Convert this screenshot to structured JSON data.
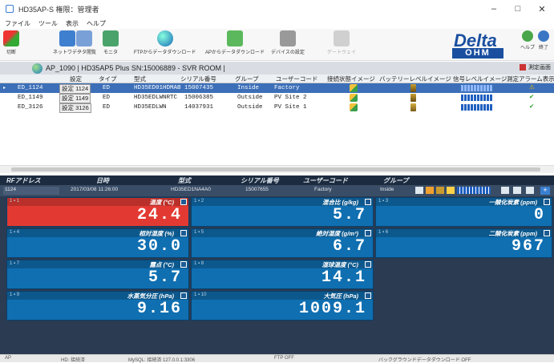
{
  "window": {
    "title": "HD35AP-S 権限：管理者"
  },
  "menu": [
    "ファイル",
    "ツール",
    "表示",
    "ヘルプ"
  ],
  "toolbar": {
    "items": [
      "切断",
      "ネットワーク",
      "データ閲覧",
      "モニタ",
      "FTPからデータダウンロード",
      "APからデータダウンロード",
      "デバイスの設定",
      "ゲートウェイ"
    ],
    "help": "ヘルプ",
    "exit": "終了"
  },
  "logo": {
    "top": "Delta",
    "bottom": "OHM",
    "color": "#1a4fa0"
  },
  "infobar": {
    "text": "AP_1090 | HD35AP5 Plus SN:15006889 - SVR ROOM |",
    "channel_label": "測定画面"
  },
  "table": {
    "headers": [
      "設定",
      "タイプ",
      "型式",
      "シリアル番号",
      "グループ",
      "ユーザーコード",
      "接続状態イメージ",
      "バッテリーレベルイメージ",
      "信号レベルイメージ",
      "測定アラーム表示"
    ],
    "rows": [
      {
        "id": "ED_1124",
        "setting": "設定",
        "code": "1124",
        "type": "ED",
        "model": "HD35ED01HDMAB",
        "serial": "15007435",
        "group": "Inside",
        "user": "Factory",
        "alarm": "⚠"
      },
      {
        "id": "ED_1149",
        "setting": "設定",
        "code": "1149",
        "type": "ED",
        "model": "HD35EDLWNRTC",
        "serial": "15006385",
        "group": "Outside",
        "user": "PV Site 2",
        "alarm": "✔"
      },
      {
        "id": "ED_3126",
        "setting": "設定",
        "code": "3126",
        "type": "ED",
        "model": "HD35EDLWN",
        "serial": "14037931",
        "group": "Outside",
        "user": "PV Site 1",
        "alarm": "✔"
      }
    ]
  },
  "detail": {
    "headers": [
      "RFアドレス",
      "日時",
      "型式",
      "シリアル番号",
      "ユーザーコード",
      "グループ"
    ],
    "values": [
      "1124",
      "2017/03/08 11:26:00",
      "HD35ED1NA4A0",
      "15007655",
      "Factory",
      "Inside"
    ]
  },
  "tiles": [
    {
      "name": "温度 (°C)",
      "value": "24.4",
      "alarm": true
    },
    {
      "name": "混合比 (g/kg)",
      "value": "5.7"
    },
    {
      "name": "一酸化炭素 (ppm)",
      "value": "0"
    },
    {
      "name": "相対湿度 (%)",
      "value": "30.0"
    },
    {
      "name": "絶対湿度 (g/m³)",
      "value": "6.7"
    },
    {
      "name": "二酸化炭素 (ppm)",
      "value": "967"
    },
    {
      "name": "露点 (°C)",
      "value": "5.7"
    },
    {
      "name": "湿球温度 (°C)",
      "value": "14.1"
    },
    {
      "name": "水蒸気分圧 (hPa)",
      "value": "9.16"
    },
    {
      "name": "大気圧 (hPa)",
      "value": "1009.1"
    }
  ],
  "status": [
    "AP",
    "HD: 接続済",
    "MySQL: 接続済 127.0.0.1:3306",
    "FTP OFF",
    "バックグラウンドデータダウンロード OFF"
  ]
}
